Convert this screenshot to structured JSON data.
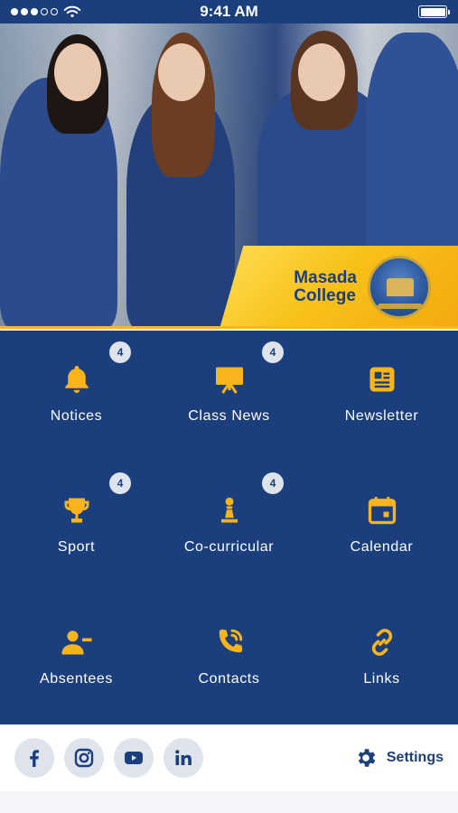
{
  "status_bar": {
    "time": "9:41 AM"
  },
  "hero": {
    "logo_line1": "Masada",
    "logo_line2": "College"
  },
  "menu": [
    {
      "label": "Notices",
      "icon": "bell-icon",
      "badge": "4"
    },
    {
      "label": "Class News",
      "icon": "presentation-board-icon",
      "badge": "4"
    },
    {
      "label": "Newsletter",
      "icon": "newsletter-icon",
      "badge": ""
    },
    {
      "label": "Sport",
      "icon": "trophy-icon",
      "badge": "4"
    },
    {
      "label": "Co-curricular",
      "icon": "chess-pawn-icon",
      "badge": "4"
    },
    {
      "label": "Calendar",
      "icon": "calendar-icon",
      "badge": ""
    },
    {
      "label": "Absentees",
      "icon": "person-minus-icon",
      "badge": ""
    },
    {
      "label": "Contacts",
      "icon": "phone-icon",
      "badge": ""
    },
    {
      "label": "Links",
      "icon": "link-icon",
      "badge": ""
    }
  ],
  "socials": [
    {
      "name": "facebook-icon"
    },
    {
      "name": "instagram-icon"
    },
    {
      "name": "youtube-icon"
    },
    {
      "name": "linkedin-icon"
    }
  ],
  "settings_label": "Settings",
  "colors": {
    "brand_blue": "#1b3f7c",
    "accent_yellow": "#f8b41a",
    "badge_bg": "#dfe4ec"
  }
}
